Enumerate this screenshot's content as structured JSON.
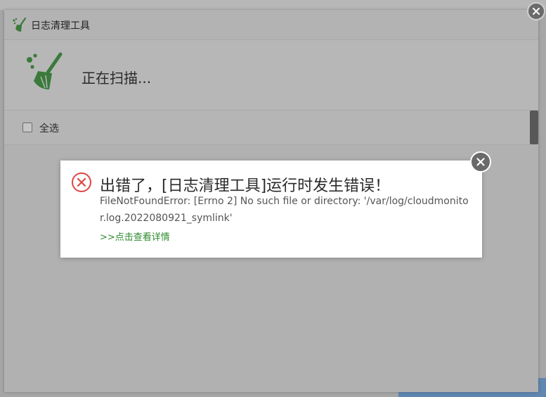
{
  "window": {
    "title": "日志清理工具",
    "scan_status": "正在扫描...",
    "select_all_label": "全选"
  },
  "icons": {
    "app_icon": "broom-icon",
    "scan_icon": "broom-icon",
    "error_icon": "error-circle-x-icon",
    "close_icon": "close-icon"
  },
  "error_dialog": {
    "title": "出错了，[日志清理工具]运行时发生错误！",
    "message": "FileNotFoundError: [Errno 2] No such file or directory: '/var/log/cloudmonitor.log.2022080921_symlink'",
    "details_link": ">>点击查看详情"
  },
  "colors": {
    "accent_green": "#2e8b2e",
    "error_red": "#e04646",
    "overlay_gray": "#a6a6a6"
  }
}
